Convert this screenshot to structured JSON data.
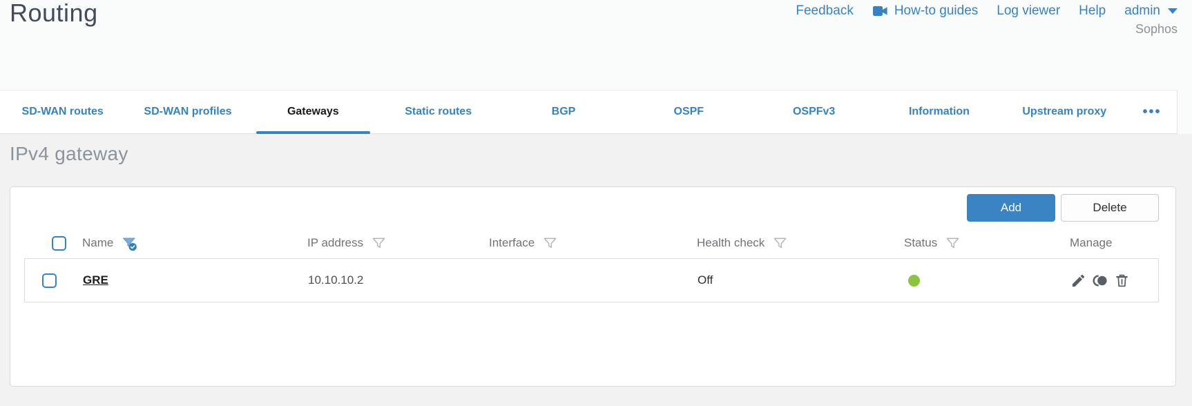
{
  "header": {
    "title": "Routing",
    "links": {
      "feedback": "Feedback",
      "howto": "How-to guides",
      "logviewer": "Log viewer",
      "help": "Help"
    },
    "user": "admin",
    "brand": "Sophos"
  },
  "tabs": [
    {
      "label": "SD-WAN routes",
      "active": false
    },
    {
      "label": "SD-WAN profiles",
      "active": false
    },
    {
      "label": "Gateways",
      "active": true
    },
    {
      "label": "Static routes",
      "active": false
    },
    {
      "label": "BGP",
      "active": false
    },
    {
      "label": "OSPF",
      "active": false
    },
    {
      "label": "OSPFv3",
      "active": false
    },
    {
      "label": "Information",
      "active": false
    },
    {
      "label": "Upstream proxy",
      "active": false
    }
  ],
  "tabs_more": "•••",
  "section": {
    "heading": "IPv4 gateway"
  },
  "toolbar": {
    "add": "Add",
    "delete": "Delete"
  },
  "table": {
    "columns": [
      {
        "label": "Name",
        "filter": "active"
      },
      {
        "label": "IP address",
        "filter": "default"
      },
      {
        "label": "Interface",
        "filter": "default"
      },
      {
        "label": "Health check",
        "filter": "default"
      },
      {
        "label": "Status",
        "filter": "default"
      },
      {
        "label": "Manage",
        "filter": "none"
      }
    ],
    "rows": [
      {
        "name": "GRE",
        "ip": "10.10.10.2",
        "interface": "",
        "health_check": "Off",
        "status_color": "#8bc53f"
      }
    ]
  },
  "icons": {
    "video": "video-camera-icon",
    "caret": "caret-down-icon",
    "filter": "funnel-filter-icon",
    "filter_active": "funnel-filter-active-icon",
    "edit": "pencil-edit-icon",
    "clone": "clone-icon",
    "trash": "trash-delete-icon"
  },
  "colors": {
    "accent_blue": "#3583c4",
    "status_green": "#8bc53f",
    "title_gray": "#434c5b"
  }
}
